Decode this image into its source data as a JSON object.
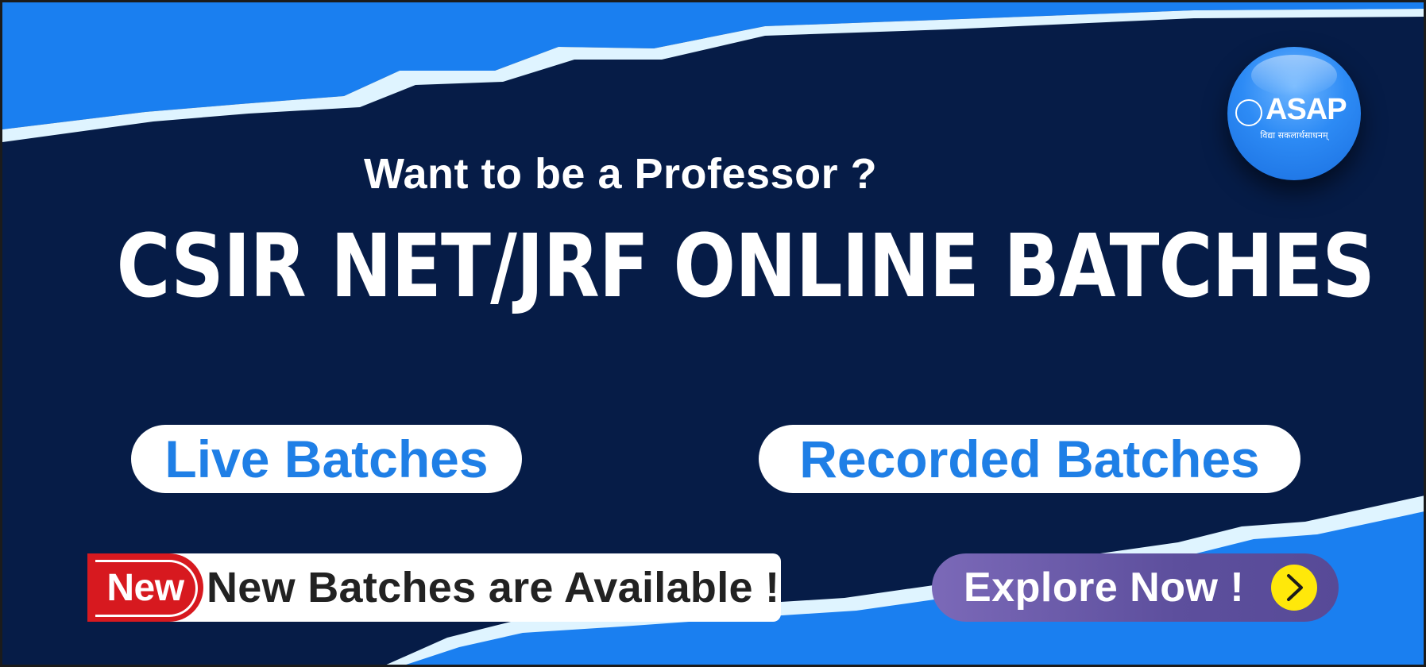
{
  "banner": {
    "subtitle": "Want to be a Professor ?",
    "headline": "CSIR NET/JRF ONLINE BATCHES",
    "live_batches": "Live Batches",
    "recorded_batches": "Recorded Batches",
    "new_badge": "New",
    "new_message": "New Batches are Available !",
    "explore_label": "Explore Now !"
  },
  "logo": {
    "name": "ASAP",
    "tagline": "विद्या सकलार्थसाधनम्"
  },
  "colors": {
    "background": "#061c47",
    "accent_blue": "#1f7fe6",
    "badge_red": "#d7191f",
    "explore_purple": "#6a5aa8",
    "chevron_yellow": "#ffe80a"
  },
  "icons": {
    "explore_arrow": "chevron-right-icon",
    "logo_seal": "seal-icon"
  }
}
